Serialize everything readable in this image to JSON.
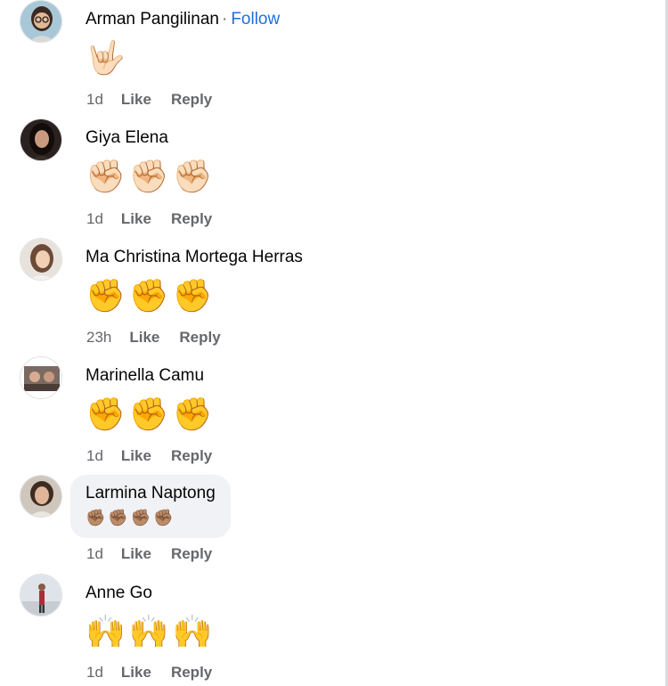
{
  "comments": [
    {
      "author": "Arman Pangilinan",
      "separator": "·",
      "follow_label": "Follow",
      "emojis": [
        "🤟🏻"
      ],
      "time": "1d",
      "like_label": "Like",
      "reply_label": "Reply",
      "avatar_icon": "avatar-woman-glasses"
    },
    {
      "author": "Giya Elena",
      "emojis": [
        "✊🏻",
        "✊🏻",
        "✊🏻"
      ],
      "time": "1d",
      "like_label": "Like",
      "reply_label": "Reply",
      "avatar_icon": "avatar-woman-dark-hair"
    },
    {
      "author": "Ma Christina Mortega Herras",
      "emojis": [
        "✊",
        "✊",
        "✊"
      ],
      "time": "23h",
      "like_label": "Like",
      "reply_label": "Reply",
      "avatar_icon": "avatar-woman-light"
    },
    {
      "author": "Marinella Camu",
      "emojis": [
        "✊",
        "✊",
        "✊"
      ],
      "time": "1d",
      "like_label": "Like",
      "reply_label": "Reply",
      "avatar_icon": "avatar-group-photo"
    },
    {
      "author": "Larmina Naptong",
      "emojis": [
        "✊🏽",
        "✊🏽",
        "✊🏽",
        "✊🏽"
      ],
      "time": "1d",
      "like_label": "Like",
      "reply_label": "Reply",
      "avatar_icon": "avatar-woman-portrait"
    },
    {
      "author": "Anne Go",
      "emojis": [
        "🙌",
        "🙌",
        "🙌"
      ],
      "time": "1d",
      "like_label": "Like",
      "reply_label": "Reply",
      "avatar_icon": "avatar-person-standing"
    }
  ],
  "colors": {
    "follow_link": "#216fdb",
    "meta_text": "#65676b",
    "bubble_bg": "#f0f2f5"
  }
}
